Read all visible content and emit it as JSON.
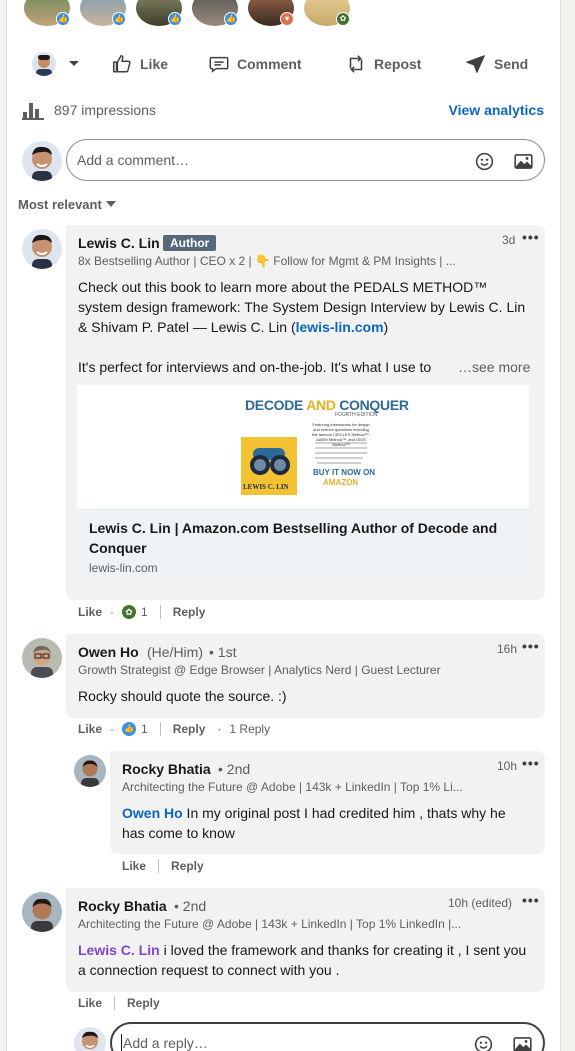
{
  "actions": {
    "like": "Like",
    "comment": "Comment",
    "repost": "Repost",
    "send": "Send"
  },
  "analytics": {
    "impressions": "897 impressions",
    "view": "View analytics"
  },
  "composer": {
    "placeholder": "Add a comment…"
  },
  "sort": {
    "label": "Most relevant"
  },
  "comments": [
    {
      "name": "Lewis C. Lin",
      "badge": "Author",
      "headline": "8x Bestselling Author | CEO x 2 | 👇 Follow for Mgmt & PM Insights | ...",
      "time": "3d",
      "text_1": "Check out this book to learn more about the PEDALS METHOD™ system design framework: The System Design Interview by Lewis C. Lin & Shivam P. Patel — Lewis C. Lin (",
      "link": "lewis-lin.com",
      "text_1_end": ")",
      "text_2": "It's perfect for interviews and on-the-job. It's what I use to",
      "see_more": "…see more",
      "preview": {
        "book_title_1": "DECODE",
        "book_title_2": "AND",
        "book_title_3": "CONQUER",
        "edition": "FOURTH EDITION",
        "blurb": "Featuring frameworks for design and metrics questions including the famous CIRCLES Method™, AARM Method™, and DIGS Method™",
        "buy": "BUY IT NOW ON",
        "buy_where": "AMAZON",
        "author_on_cover": "LEWIS C. LIN",
        "title": "Lewis C. Lin | Amazon.com Bestselling Author of Decode and Conquer",
        "domain": "lewis-lin.com"
      },
      "like_label": "Like",
      "reaction_count": "1",
      "reply_label": "Reply"
    },
    {
      "name": "Owen Ho",
      "pronouns": "(He/Him)",
      "degree": "• 1st",
      "headline": "Growth Strategist @ Edge Browser | Analytics Nerd | Guest Lecturer",
      "time": "16h",
      "text": "Rocky should quote the source. :)",
      "like_label": "Like",
      "reaction_count": "1",
      "reply_label": "Reply",
      "replies": "1 Reply"
    },
    {
      "name": "Rocky Bhatia",
      "degree": "• 2nd",
      "headline": "Architecting the Future @ Adobe | 143k + LinkedIn | Top 1% Li...",
      "time": "10h",
      "mention": "Owen Ho",
      "text": " In my original post I had credited him , thats why he has come to know",
      "like_label": "Like",
      "reply_label": "Reply"
    },
    {
      "name": "Rocky Bhatia",
      "degree": "• 2nd",
      "headline": "Architecting the Future @ Adobe | 143k + LinkedIn | Top 1% LinkedIn |...",
      "time": "10h (edited)",
      "mention": "Lewis C. Lin",
      "text": " i loved the framework and thanks for creating it , I sent you a connection request to connect with you .",
      "like_label": "Like",
      "reply_label": "Reply"
    }
  ],
  "reply_composer": {
    "placeholder": "Add a reply…"
  },
  "colors": {
    "accent": "#0a66c2",
    "mention_visited": "#8344cc",
    "bubble": "#f2f2f2"
  }
}
